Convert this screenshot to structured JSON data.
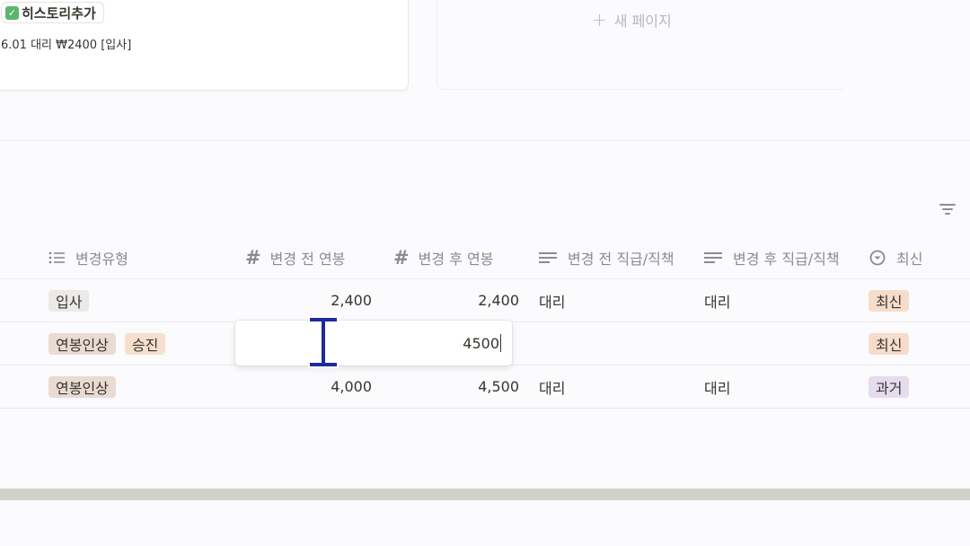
{
  "board": {
    "card": {
      "title": "히스토리추가",
      "text": "6.01 대리 ₩2400 [입사]"
    },
    "new_page_label": "새 페이지"
  },
  "table": {
    "columns": [
      {
        "label": "변경유형",
        "icon": "list-icon"
      },
      {
        "label": "변경 전 연봉",
        "icon": "number-icon"
      },
      {
        "label": "변경 후 연봉",
        "icon": "number-icon"
      },
      {
        "label": "변경 전 직급/직책",
        "icon": "text-icon"
      },
      {
        "label": "변경 후 직급/직책",
        "icon": "text-icon"
      },
      {
        "label": "최신",
        "icon": "status-icon"
      }
    ],
    "rows": [
      {
        "types": [
          "입사"
        ],
        "before_salary": "2,400",
        "after_salary": "2,400",
        "before_position": "대리",
        "after_position": "대리",
        "status": "최신"
      },
      {
        "types": [
          "연봉인상",
          "승진"
        ],
        "before_salary": "",
        "after_salary": "4500",
        "before_position": "",
        "after_position": "",
        "status": "최신"
      },
      {
        "types": [
          "연봉인상"
        ],
        "before_salary": "4,000",
        "after_salary": "4,500",
        "before_position": "대리",
        "after_position": "대리",
        "status": "과거"
      }
    ]
  },
  "colors": {
    "accent_cursor": "#1d2aa0",
    "tag_latest": "#f8dccb",
    "tag_past": "#e6dcf0"
  }
}
